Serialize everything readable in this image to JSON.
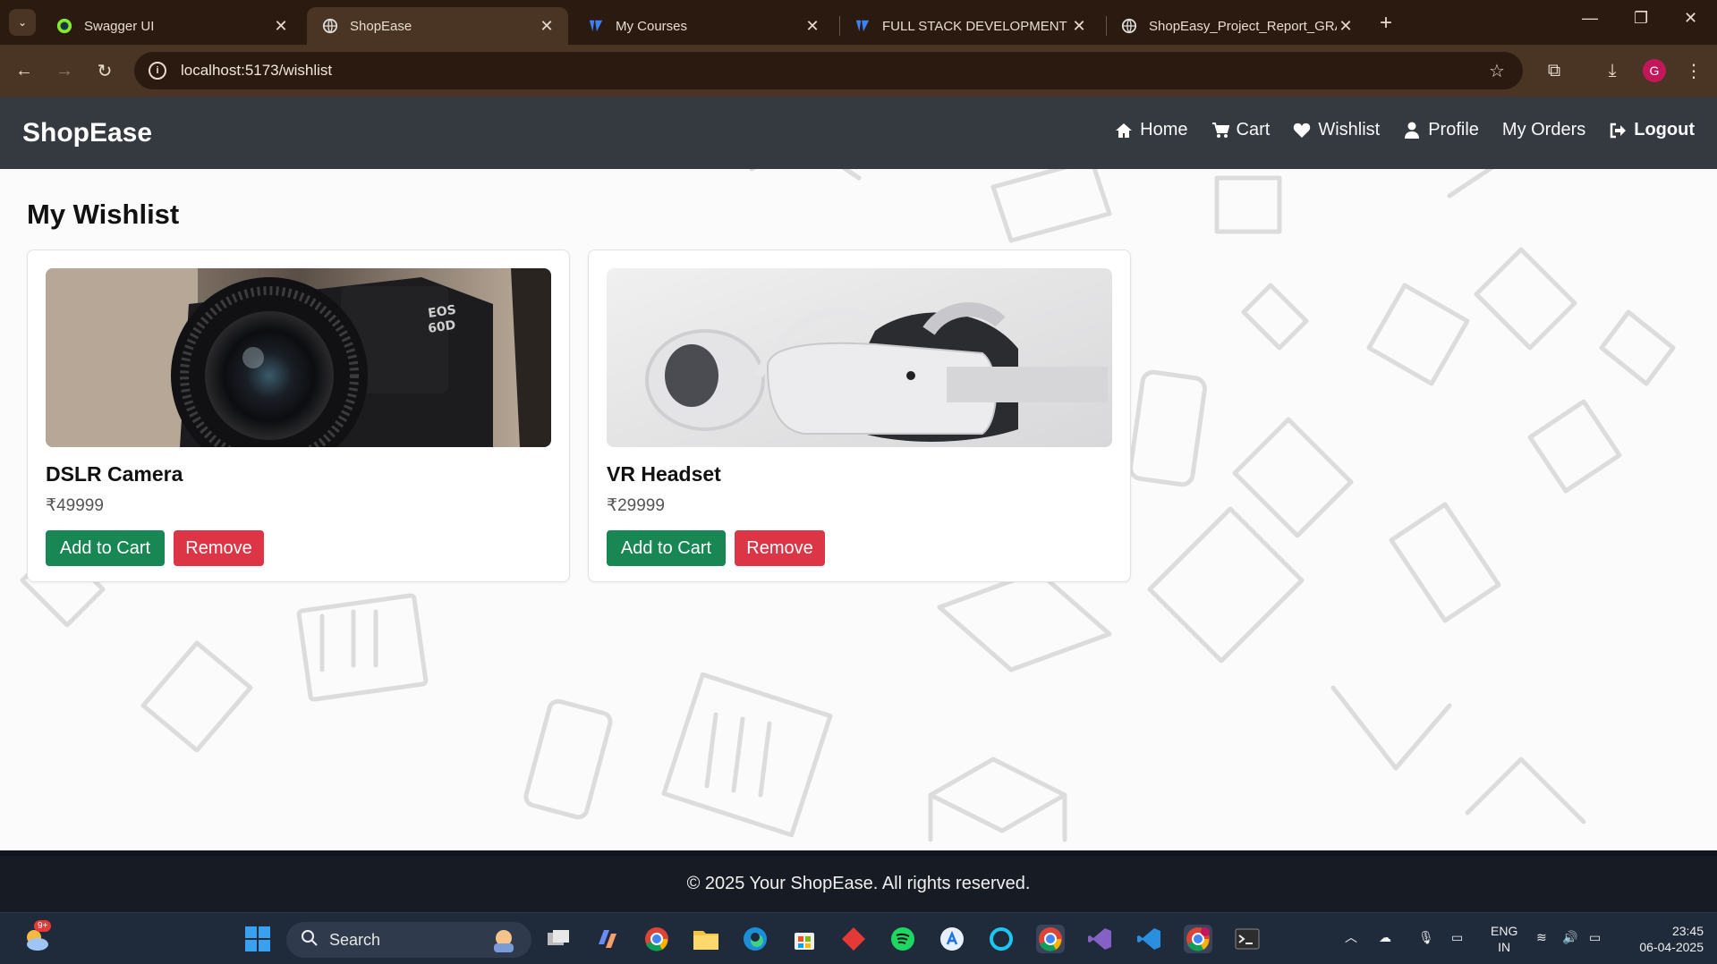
{
  "browser": {
    "tabs": [
      {
        "title": "Swagger UI",
        "icon": "swagger-icon",
        "active": false
      },
      {
        "title": "ShopEase",
        "icon": "globe-icon",
        "active": true
      },
      {
        "title": "My Courses",
        "icon": "courses-icon",
        "active": false
      },
      {
        "title": "FULL STACK DEVELOPMENT - C",
        "icon": "courses-icon",
        "active": false
      },
      {
        "title": "ShopEasy_Project_Report_GRAC",
        "icon": "globe-icon",
        "active": false
      }
    ],
    "url": "localhost:5173/wishlist",
    "profile_initial": "G"
  },
  "app": {
    "brand": "ShopEase",
    "nav": {
      "home": "Home",
      "cart": "Cart",
      "wishlist": "Wishlist",
      "profile": "Profile",
      "orders": "My Orders",
      "logout": "Logout"
    },
    "page_title": "My Wishlist",
    "items": [
      {
        "name": "DSLR Camera",
        "price": "₹49999",
        "add_label": "Add to Cart",
        "remove_label": "Remove"
      },
      {
        "name": "VR Headset",
        "price": "₹29999",
        "add_label": "Add to Cart",
        "remove_label": "Remove"
      }
    ],
    "footer": "© 2025 Your ShopEase. All rights reserved."
  },
  "taskbar": {
    "search_label": "Search",
    "weather_badge": "9+",
    "language": "ENG",
    "region": "IN",
    "time": "23:45",
    "date": "06-04-2025"
  },
  "colors": {
    "navbar": "#343a40",
    "success": "#198754",
    "danger": "#dc3545",
    "footer": "#171b24"
  }
}
